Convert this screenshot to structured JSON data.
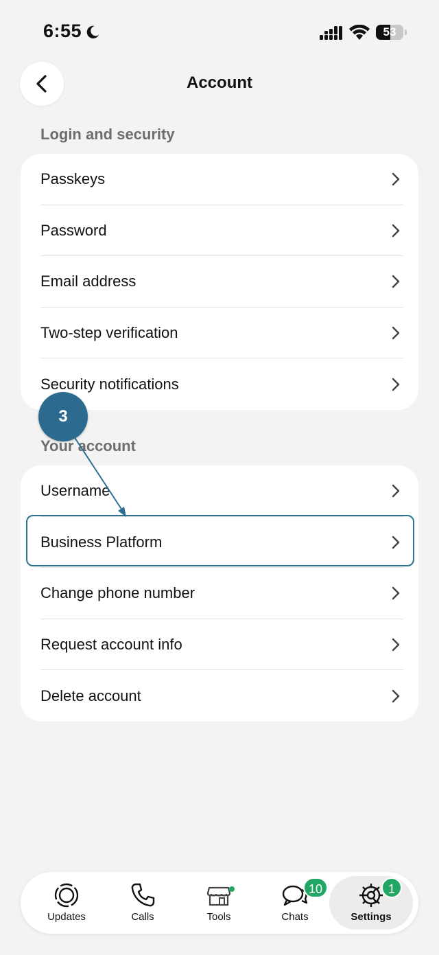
{
  "status_bar": {
    "time": "6:55",
    "battery_level": "53",
    "battery_fraction": 0.53
  },
  "header": {
    "title": "Account",
    "back_icon": "chevron-left-icon"
  },
  "sections": [
    {
      "label": "Login and security",
      "items": [
        {
          "label": "Passkeys"
        },
        {
          "label": "Password"
        },
        {
          "label": "Email address"
        },
        {
          "label": "Two-step verification"
        },
        {
          "label": "Security notifications"
        }
      ]
    },
    {
      "label": "Your account",
      "items": [
        {
          "label": "Username"
        },
        {
          "label": "Business Platform",
          "highlighted": true
        },
        {
          "label": "Change phone number"
        },
        {
          "label": "Request account info"
        },
        {
          "label": "Delete account"
        }
      ]
    }
  ],
  "annotation": {
    "step": "3",
    "color": "#2c6b8f"
  },
  "bottom_nav": {
    "items": [
      {
        "label": "Updates",
        "icon": "updates-icon"
      },
      {
        "label": "Calls",
        "icon": "phone-icon"
      },
      {
        "label": "Tools",
        "icon": "storefront-icon",
        "dot": true
      },
      {
        "label": "Chats",
        "icon": "chat-bubbles-icon",
        "badge": "10"
      },
      {
        "label": "Settings",
        "icon": "gear-icon",
        "badge": "1",
        "active": true
      }
    ]
  },
  "colors": {
    "background": "#f3f3f3",
    "card": "#ffffff",
    "accent_green": "#21a663",
    "highlight_border": "#2e7090"
  }
}
